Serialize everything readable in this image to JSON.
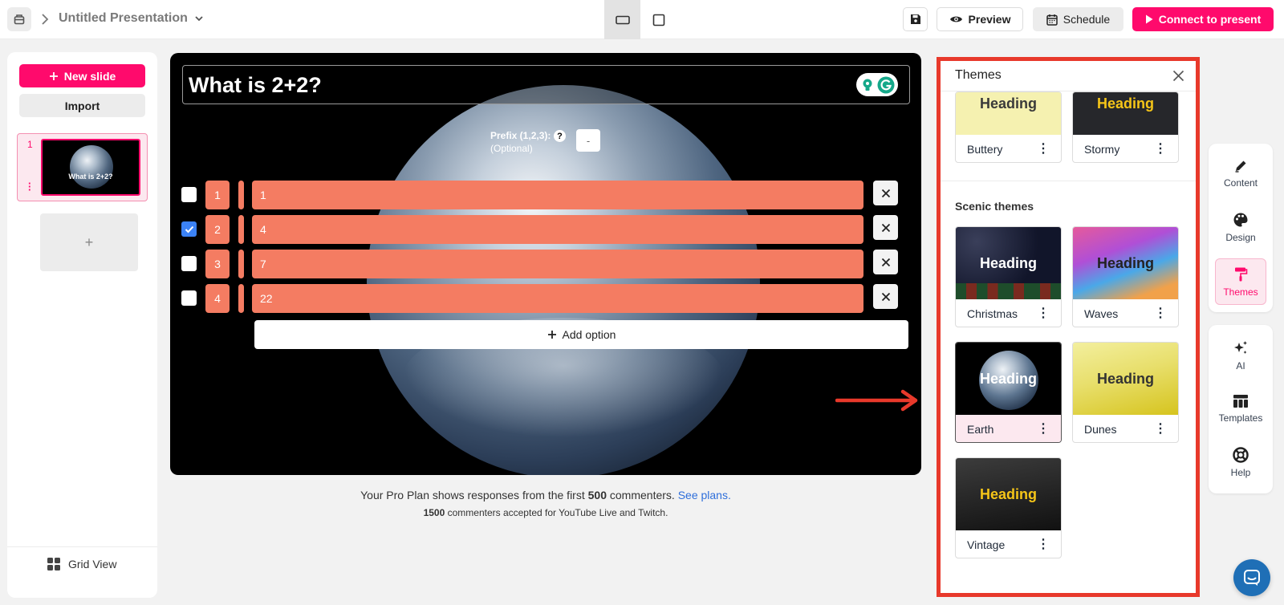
{
  "topbar": {
    "title": "Untitled Presentation",
    "preview_label": "Preview",
    "schedule_label": "Schedule",
    "present_label": "Connect to present"
  },
  "sidebar": {
    "new_slide_label": "New slide",
    "import_label": "Import",
    "slide_number": "1",
    "slide_caption": "What is 2+2?",
    "add_label": "+",
    "grid_view_label": "Grid View"
  },
  "slide": {
    "question": "What is 2+2?",
    "prefix_label": "Prefix (1,2,3):",
    "prefix_optional": "(Optional)",
    "prefix_value": "-",
    "help_glyph": "?",
    "options": [
      {
        "number": "1",
        "value": "1",
        "checked": false
      },
      {
        "number": "2",
        "value": "4",
        "checked": true
      },
      {
        "number": "3",
        "value": "7",
        "checked": false
      },
      {
        "number": "4",
        "value": "22",
        "checked": false
      }
    ],
    "add_option_label": "Add option"
  },
  "plan": {
    "line1_prefix": "Your Pro Plan shows responses from the first",
    "line1_count": "500",
    "line1_suffix": "commenters.",
    "see_plans": "See plans.",
    "line2_count": "1500",
    "line2_suffix": "commenters accepted for YouTube Live and Twitch."
  },
  "themes": {
    "title": "Themes",
    "top_row": [
      {
        "name": "Buttery",
        "heading": "Heading"
      },
      {
        "name": "Stormy",
        "heading": "Heading"
      }
    ],
    "scenic_title": "Scenic themes",
    "scenic": [
      {
        "name": "Christmas",
        "heading": "Heading"
      },
      {
        "name": "Waves",
        "heading": "Heading"
      },
      {
        "name": "Earth",
        "heading": "Heading"
      },
      {
        "name": "Dunes",
        "heading": "Heading"
      },
      {
        "name": "Vintage",
        "heading": "Heading"
      }
    ]
  },
  "rail": {
    "content": "Content",
    "design": "Design",
    "themes": "Themes",
    "ai": "AI",
    "templates": "Templates",
    "help": "Help"
  },
  "colors": {
    "brand": "#ff0a6c",
    "option": "#f47c62",
    "highlight": "#e8392b",
    "link": "#2f6fdb"
  }
}
